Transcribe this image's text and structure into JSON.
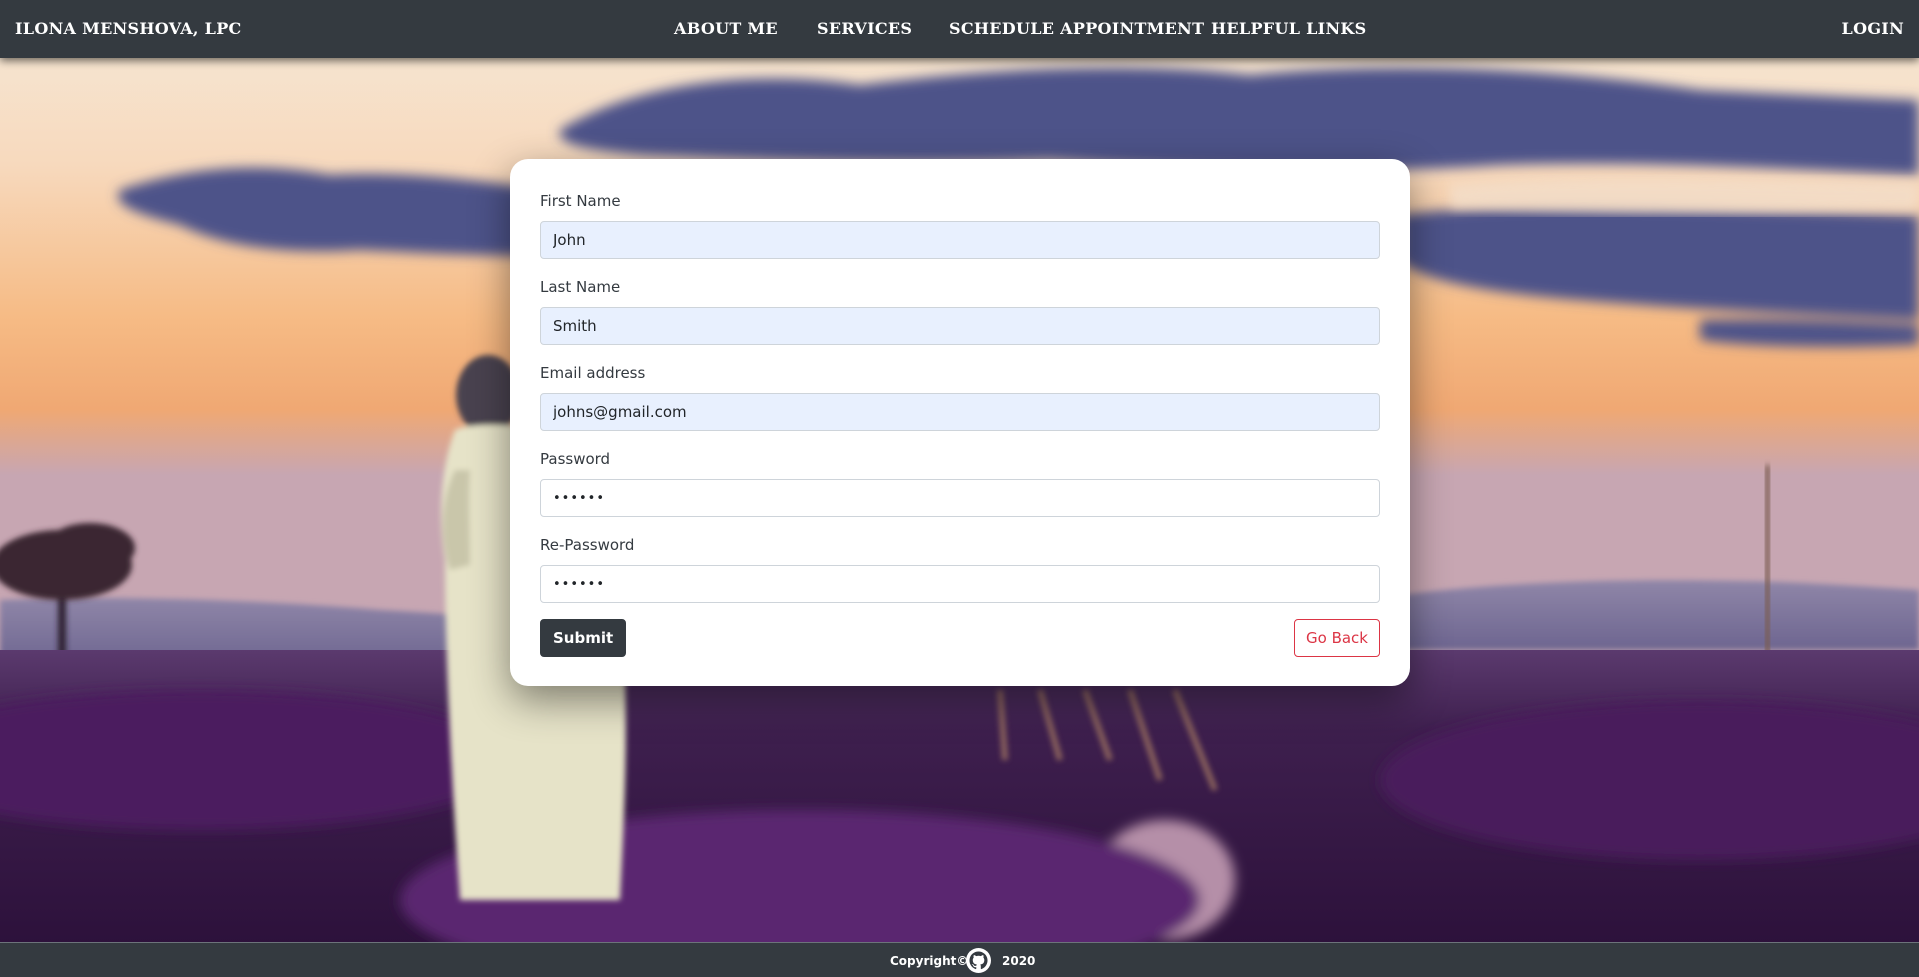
{
  "navbar": {
    "brand": "ILONA MENSHOVA, LPC",
    "items": [
      {
        "label": "ABOUT ME"
      },
      {
        "label": "SERVICES"
      },
      {
        "label": "SCHEDULE APPOINTMENT"
      },
      {
        "label": "HELPFUL LINKS"
      }
    ],
    "login": "LOGIN"
  },
  "form": {
    "first_name": {
      "label": "First Name",
      "value": "John"
    },
    "last_name": {
      "label": "Last Name",
      "value": "Smith"
    },
    "email": {
      "label": "Email address",
      "value": "johns@gmail.com"
    },
    "password": {
      "label": "Password",
      "value": "••••••"
    },
    "re_password": {
      "label": "Re-Password",
      "value": "••••••"
    },
    "submit_label": "Submit",
    "back_label": "Go Back"
  },
  "footer": {
    "copyright": "Copyright©",
    "icon": "github-icon",
    "year": "2020"
  },
  "colors": {
    "navbar": "#343a40",
    "autofill": "#e8f0fe",
    "danger": "#dc3545",
    "lavender": "#4b1f5e",
    "sky_orange": "#f4b27a",
    "cloud": "#4b4f86"
  },
  "background": {
    "icon": "lavender-field-photo"
  }
}
